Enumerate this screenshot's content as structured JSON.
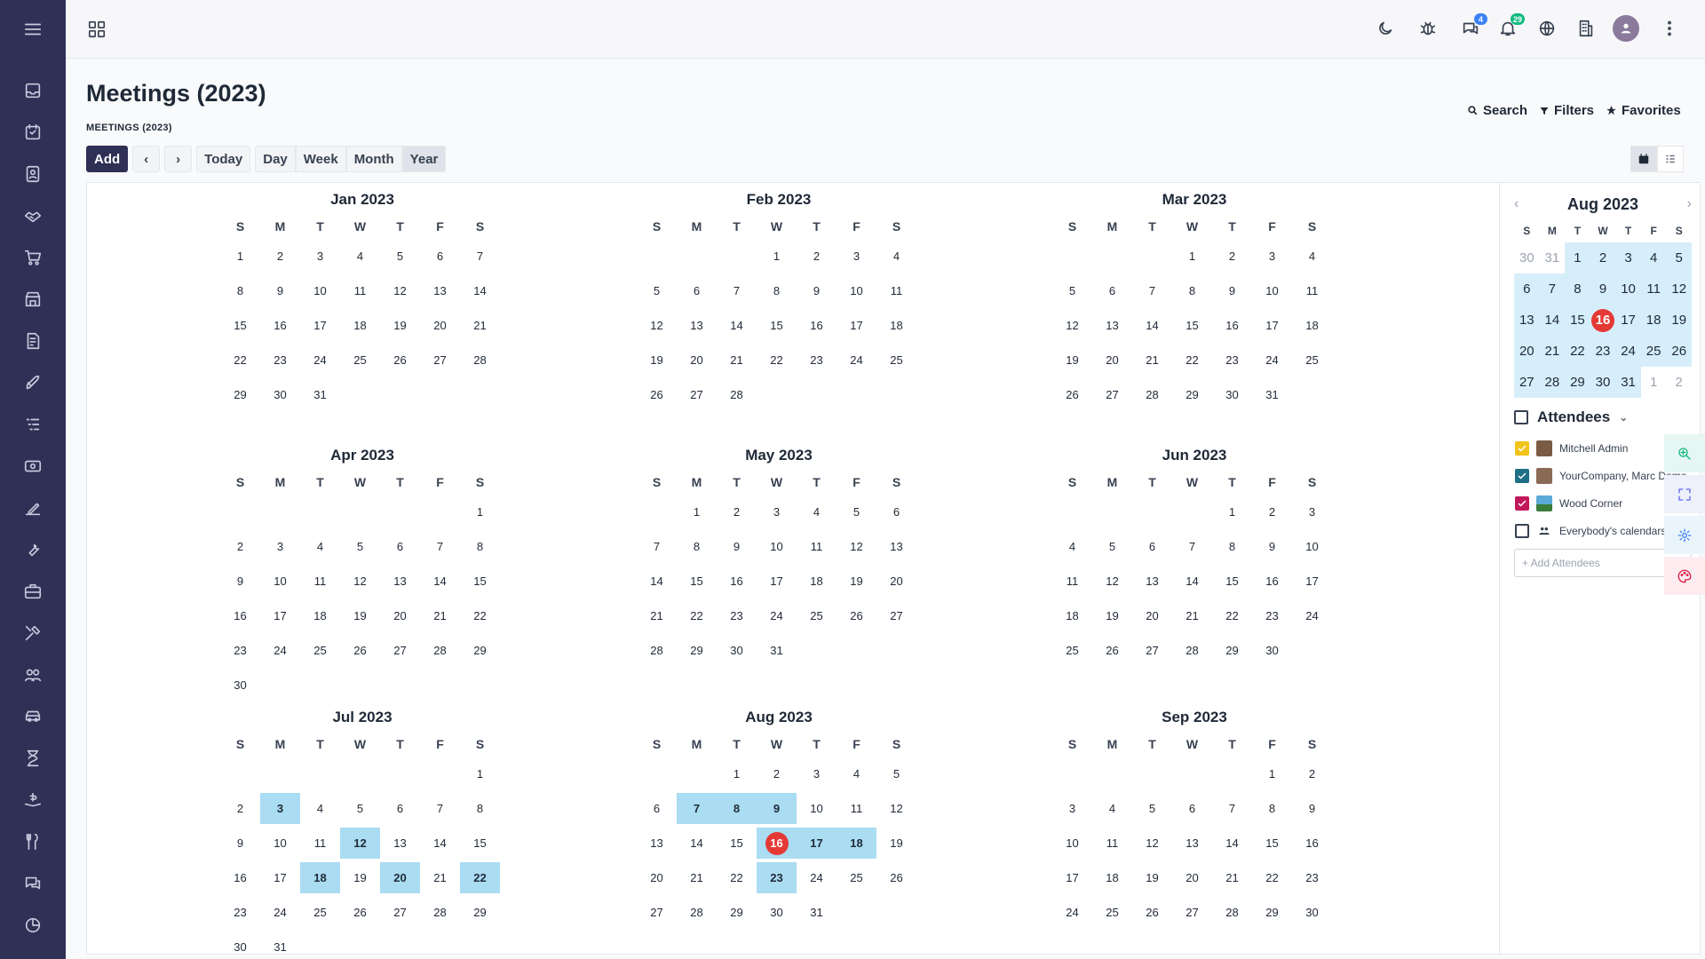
{
  "sidebar": {
    "items": [
      {
        "icon": "inbox-icon"
      },
      {
        "icon": "task-icon"
      },
      {
        "icon": "contacts-icon"
      },
      {
        "icon": "handshake-icon"
      },
      {
        "icon": "cart-icon"
      },
      {
        "icon": "store-icon"
      },
      {
        "icon": "invoice-icon"
      },
      {
        "icon": "rocket-icon"
      },
      {
        "icon": "list-icon"
      },
      {
        "icon": "money-icon"
      },
      {
        "icon": "signature-icon"
      },
      {
        "icon": "wrench-icon"
      },
      {
        "icon": "briefcase-icon"
      },
      {
        "icon": "tools-icon"
      },
      {
        "icon": "people-icon"
      },
      {
        "icon": "car-icon"
      },
      {
        "icon": "hourglass-icon"
      },
      {
        "icon": "donation-icon"
      },
      {
        "icon": "restaurant-icon"
      },
      {
        "icon": "chat-icon"
      },
      {
        "icon": "piechart-icon"
      }
    ]
  },
  "topbar": {
    "messages_count": "4",
    "notifications_count": "29",
    "colors": {
      "messages_badge": "#3b82f6",
      "notifications_badge": "#10b981"
    }
  },
  "page": {
    "title": "Meetings (2023)",
    "breadcrumb": "MEETINGS (2023)",
    "search_label": "Search",
    "filters_label": "Filters",
    "favorites_label": "Favorites"
  },
  "toolbar": {
    "add": "Add",
    "today": "Today",
    "day": "Day",
    "week": "Week",
    "month": "Month",
    "year": "Year",
    "active_view": "Year"
  },
  "calendar": {
    "weekdays": [
      "S",
      "M",
      "T",
      "W",
      "T",
      "F",
      "S"
    ],
    "months": [
      {
        "title": "Jan 2023",
        "offset": 0,
        "days": 31,
        "highlight": [],
        "today": null
      },
      {
        "title": "Feb 2023",
        "offset": 3,
        "days": 28,
        "highlight": [],
        "today": null
      },
      {
        "title": "Mar 2023",
        "offset": 3,
        "days": 31,
        "highlight": [],
        "today": null
      },
      {
        "title": "Apr 2023",
        "offset": 6,
        "days": 30,
        "highlight": [],
        "today": null
      },
      {
        "title": "May 2023",
        "offset": 1,
        "days": 31,
        "highlight": [],
        "today": null
      },
      {
        "title": "Jun 2023",
        "offset": 4,
        "days": 30,
        "highlight": [],
        "today": null
      },
      {
        "title": "Jul 2023",
        "offset": 6,
        "days": 31,
        "highlight": [
          3,
          12,
          18,
          20,
          22
        ],
        "today": null
      },
      {
        "title": "Aug 2023",
        "offset": 2,
        "days": 31,
        "highlight": [
          7,
          8,
          9,
          16,
          17,
          18,
          23
        ],
        "today": 16
      },
      {
        "title": "Sep 2023",
        "offset": 5,
        "days": 30,
        "highlight": [],
        "today": null
      }
    ],
    "highlight_color": "#aadcf2",
    "today_color": "#e53935"
  },
  "mini": {
    "title": "Aug 2023",
    "weekdays": [
      "S",
      "M",
      "T",
      "W",
      "T",
      "F",
      "S"
    ],
    "rows": [
      [
        "30",
        "31",
        "1",
        "2",
        "3",
        "4",
        "5"
      ],
      [
        "6",
        "7",
        "8",
        "9",
        "10",
        "11",
        "12"
      ],
      [
        "13",
        "14",
        "15",
        "16",
        "17",
        "18",
        "19"
      ],
      [
        "20",
        "21",
        "22",
        "23",
        "24",
        "25",
        "26"
      ],
      [
        "27",
        "28",
        "29",
        "30",
        "31",
        "1",
        "2"
      ]
    ],
    "today": "16"
  },
  "attendees": {
    "label": "Attendees",
    "items": [
      {
        "name": "Mitchell Admin",
        "checked": true,
        "color": "#f0c419",
        "avatar": "#7a5c44"
      },
      {
        "name": "YourCompany, Marc Demo",
        "checked": true,
        "color": "#1f6f86",
        "avatar": "#8a6a55"
      },
      {
        "name": "Wood Corner",
        "checked": true,
        "color": "#c2185b",
        "avatar": "#5aa9d6"
      },
      {
        "name": "Everybody's calendars",
        "checked": false,
        "color": "#374151",
        "avatar": "people"
      }
    ],
    "add_placeholder": "+ Add Attendees"
  }
}
